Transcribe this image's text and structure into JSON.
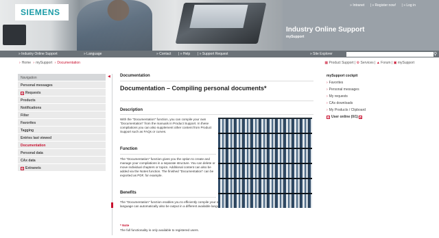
{
  "header": {
    "logo": "SIEMENS",
    "top_links": [
      "» Intranet",
      "| » Register now!",
      "| » Log in"
    ],
    "banner_title": "Industry Online Support",
    "banner_subtitle": "mySupport"
  },
  "navbar": {
    "items": [
      "» Industry Online Support",
      "» Language",
      "» Contact",
      "| » Help",
      "| » Support Request",
      "» Site Explorer"
    ],
    "search_placeholder": ""
  },
  "breadcrumb": {
    "items": [
      "Home",
      "mySupport",
      "Documentation"
    ]
  },
  "top_right_links": [
    "Product Support",
    "Services",
    "Forum",
    "mySupport"
  ],
  "leftnav": {
    "heading": "Navigation",
    "items": [
      {
        "label": "Personal messages",
        "plus": false,
        "active": false
      },
      {
        "label": "Requests",
        "plus": true,
        "active": false
      },
      {
        "label": "Products",
        "plus": false,
        "active": false
      },
      {
        "label": "Notifications",
        "plus": false,
        "active": false
      },
      {
        "label": "Filter",
        "plus": false,
        "active": false
      },
      {
        "label": "Favorites",
        "plus": false,
        "active": false
      },
      {
        "label": "Tagging",
        "plus": false,
        "active": false
      },
      {
        "label": "Entries last viewed",
        "plus": false,
        "active": false
      },
      {
        "label": "Documentation",
        "plus": false,
        "active": true
      },
      {
        "label": "Personal data",
        "plus": false,
        "active": false
      },
      {
        "label": "CAx data",
        "plus": false,
        "active": false
      },
      {
        "label": "Extranets",
        "plus": true,
        "active": false
      }
    ]
  },
  "main": {
    "label": "Documentation",
    "title": "Documentation – Compiling personal documents*",
    "description_heading": "Description",
    "description_text": "With the \"Documentation\" function, you can compile your own \"Documentation\" from the manuals in Product Support. In these compilations you can also supplement other content from Product Support such as FAQs or curves.",
    "function_heading": "Function",
    "function_text": "The \"Documentation\" function gives you the option to create and manage your compilations in a separate structure. You can delete or move individual chapters or topics. Additional content can also be added via the Notes function. The finished \"Documentation\" can be exported as PDF, for example.",
    "benefits_heading": "Benefits",
    "benefits_text": "The \"Documentation\" function enables you to efficiently compile your own system documentation. The \"Documentation\" compiled in one language can automatically also be output in a different available language.",
    "note_heading": "* Note",
    "note_text": "The full functionality is only available to registered users."
  },
  "cockpit": {
    "title": "mySupport cockpit",
    "links": [
      "Favorites",
      "Personal messages",
      "My requests",
      "CAx downloads",
      "My Products / Clipboard"
    ],
    "online": "User online (0/1)"
  }
}
